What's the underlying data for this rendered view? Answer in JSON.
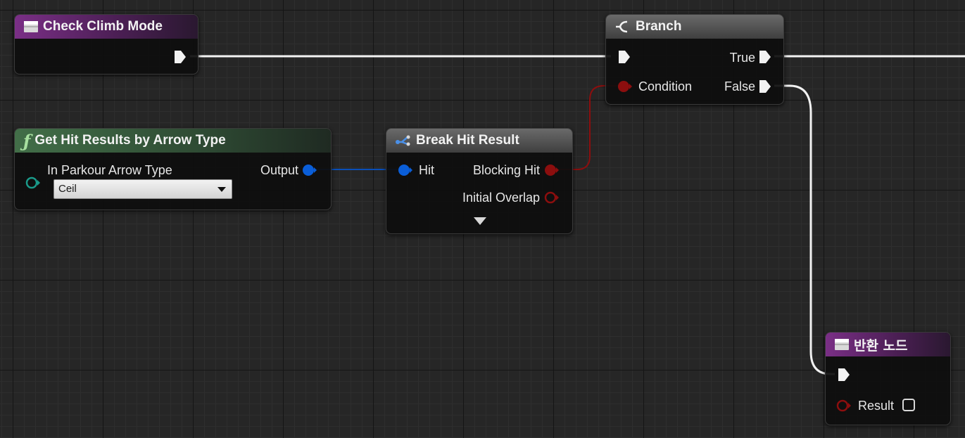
{
  "colors": {
    "exec_wire": "#f2f2f2",
    "struct_pin": "#0a5ed8",
    "bool_pin": "#8c0e0e",
    "object_pin": "#1a9a8a",
    "function_header": "#426e48",
    "event_header": "#7a2f86",
    "branch_header": "#5a5a5a"
  },
  "nodes": {
    "check_climb_mode": {
      "title": "Check Climb Mode",
      "icon": "function-entry-icon"
    },
    "branch": {
      "title": "Branch",
      "icon": "branch-icon",
      "condition_label": "Condition",
      "true_label": "True",
      "false_label": "False"
    },
    "get_hit_results": {
      "title": "Get Hit Results by Arrow Type",
      "icon": "function-f-icon",
      "input_label": "In Parkour Arrow Type",
      "input_value": "Ceil",
      "output_label": "Output"
    },
    "break_hit_result": {
      "title": "Break Hit Result",
      "icon": "break-struct-icon",
      "hit_label": "Hit",
      "blocking_hit_label": "Blocking Hit",
      "initial_overlap_label": "Initial Overlap"
    },
    "return_node": {
      "title": "반환 노드",
      "icon": "return-node-icon",
      "result_label": "Result",
      "result_checked": false
    }
  }
}
